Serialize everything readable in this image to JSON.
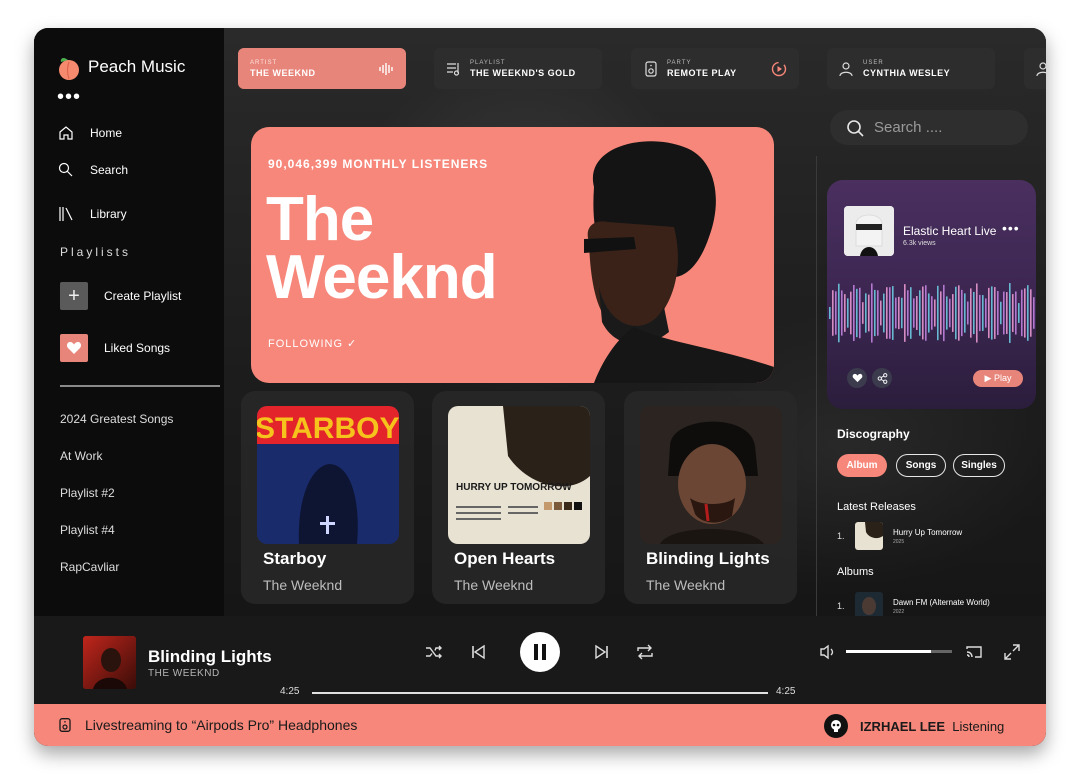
{
  "app": {
    "name": "Peach Music",
    "more_label": "•••"
  },
  "sidebar": {
    "nav": [
      {
        "label": "Home",
        "icon": "home-icon"
      },
      {
        "label": "Search",
        "icon": "search-icon"
      },
      {
        "label": "Library",
        "icon": "library-icon"
      }
    ],
    "playlists_heading": "Playlists",
    "create_playlist": "Create Playlist",
    "liked_songs": "Liked Songs",
    "playlists": [
      "2024 Greatest Songs",
      "At Work",
      "Playlist #2",
      "Playlist #4",
      "RapCavliar"
    ]
  },
  "tabs": [
    {
      "kind": "ARTIST",
      "value": "THE WEEKND",
      "icon": "waveform-icon"
    },
    {
      "kind": "PLAYLIST",
      "value": "THE WEEKND'S GOLD",
      "icon": "playlist-icon"
    },
    {
      "kind": "PARTY",
      "value": "REMOTE PLAY",
      "icon": "speaker-icon"
    },
    {
      "kind": "USER",
      "value": "CYNTHIA WESLEY",
      "icon": "user-icon"
    }
  ],
  "hero": {
    "listeners": "90,046,399 MONTHLY LISTENERS",
    "artist_line1": "The",
    "artist_line2": "Weeknd",
    "following": "FOLLOWING ✓"
  },
  "albums": [
    {
      "title": "Starboy",
      "artist": "The Weeknd",
      "cover_text": "STARBOY"
    },
    {
      "title": "Open Hearts",
      "artist": "The Weeknd",
      "cover_text": "HURRY UP TOMORROW"
    },
    {
      "title": "Blinding Lights",
      "artist": "The Weeknd"
    }
  ],
  "search": {
    "placeholder": "Search ...."
  },
  "now_card": {
    "title": "Elastic Heart Live",
    "views": "6.3k views",
    "more": "•••",
    "play": "▶ Play"
  },
  "discography": {
    "heading": "Discography",
    "filters": [
      {
        "label": "Album",
        "active": true
      },
      {
        "label": "Songs",
        "active": false
      },
      {
        "label": "Singles",
        "active": false
      }
    ],
    "latest_heading": "Latest Releases",
    "latest": [
      {
        "n": "1.",
        "title": "Hurry Up Tomorrow",
        "year": "2025"
      }
    ],
    "albums_heading": "Albums",
    "albums": [
      {
        "n": "1.",
        "title": "Dawn FM (Alternate World)",
        "year": "2022"
      }
    ]
  },
  "player": {
    "song": "Blinding Lights",
    "artist": "THE WEEKND",
    "elapsed": "4:25",
    "duration": "4:25",
    "progress": 1.0,
    "volume": 0.8
  },
  "banner": {
    "stream": "Livestreaming to “Airpods Pro” Headphones",
    "user": "IZRHAEL LEE",
    "status": "Listening"
  },
  "colors": {
    "accent": "#f6877a",
    "tab_active": "#e8857a",
    "background": "#141414",
    "sidebar": "#0c0c0c"
  }
}
